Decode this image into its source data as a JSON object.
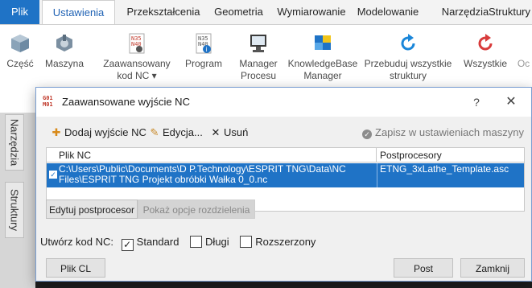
{
  "tabs": [
    "Plik",
    "Ustawienia",
    "Przekształcenia",
    "Geometria",
    "Wymiarowanie",
    "Modelowanie",
    "Narzędzia",
    "Struktury"
  ],
  "ribbon": {
    "items": [
      {
        "label": "Część",
        "icon": "part-cube-icon"
      },
      {
        "label": "Maszyna",
        "icon": "machine-icon"
      },
      {
        "label": "Zaawansowany kod NC ▾",
        "icon": "nc-code-settings-icon"
      },
      {
        "label": "Program",
        "icon": "nc-program-info-icon"
      },
      {
        "label": "Manager Procesu",
        "icon": "process-manager-icon"
      },
      {
        "label": "KnowledgeBase Manager",
        "icon": "knowledgebase-icon"
      },
      {
        "label": "Przebuduj wszystkie struktury",
        "icon": "rebuild-icon"
      },
      {
        "label": "Wszystkie",
        "icon": "rebuild-all-icon"
      },
      {
        "label": "Oc",
        "icon": ""
      }
    ]
  },
  "side_tabs": [
    "Narzędzia",
    "Struktury"
  ],
  "dialog": {
    "title": "Zaawansowane wyjście NC",
    "help": "?",
    "close": "✕",
    "toolbar": {
      "add": "Dodaj wyjście NC",
      "edit": "Edycja...",
      "remove": "Usuń",
      "save": "Zapisz w ustawieniach maszyny"
    },
    "table": {
      "headers": [
        "Plik NC",
        "Postprocesory"
      ],
      "rows": [
        {
          "checked": true,
          "file_line1": "C:\\Users\\Public\\Documents\\D P.Technology\\ESPRIT TNG\\Data\\NC",
          "file_line2": "Files\\ESPRIT TNG Projekt obróbki Wałka 0_0.nc",
          "post": "ETNG_3xLathe_Template.asc"
        }
      ]
    },
    "buttons": {
      "edit_post": "Edytuj postprocesor",
      "show_split": "Pokaż opcje rozdzielenia",
      "plik_cl": "Plik CL",
      "post": "Post",
      "close": "Zamknij"
    },
    "generate": {
      "label": "Utwórz kod NC:",
      "options": [
        {
          "label": "Standard",
          "checked": true
        },
        {
          "label": "Długi",
          "checked": false
        },
        {
          "label": "Rozszerzony",
          "checked": false
        }
      ]
    }
  },
  "colors": {
    "accent": "#1f73c6",
    "selection": "#1f73c6",
    "rebuild_blue": "#1a86d9",
    "rebuild_red": "#d83b3b"
  }
}
